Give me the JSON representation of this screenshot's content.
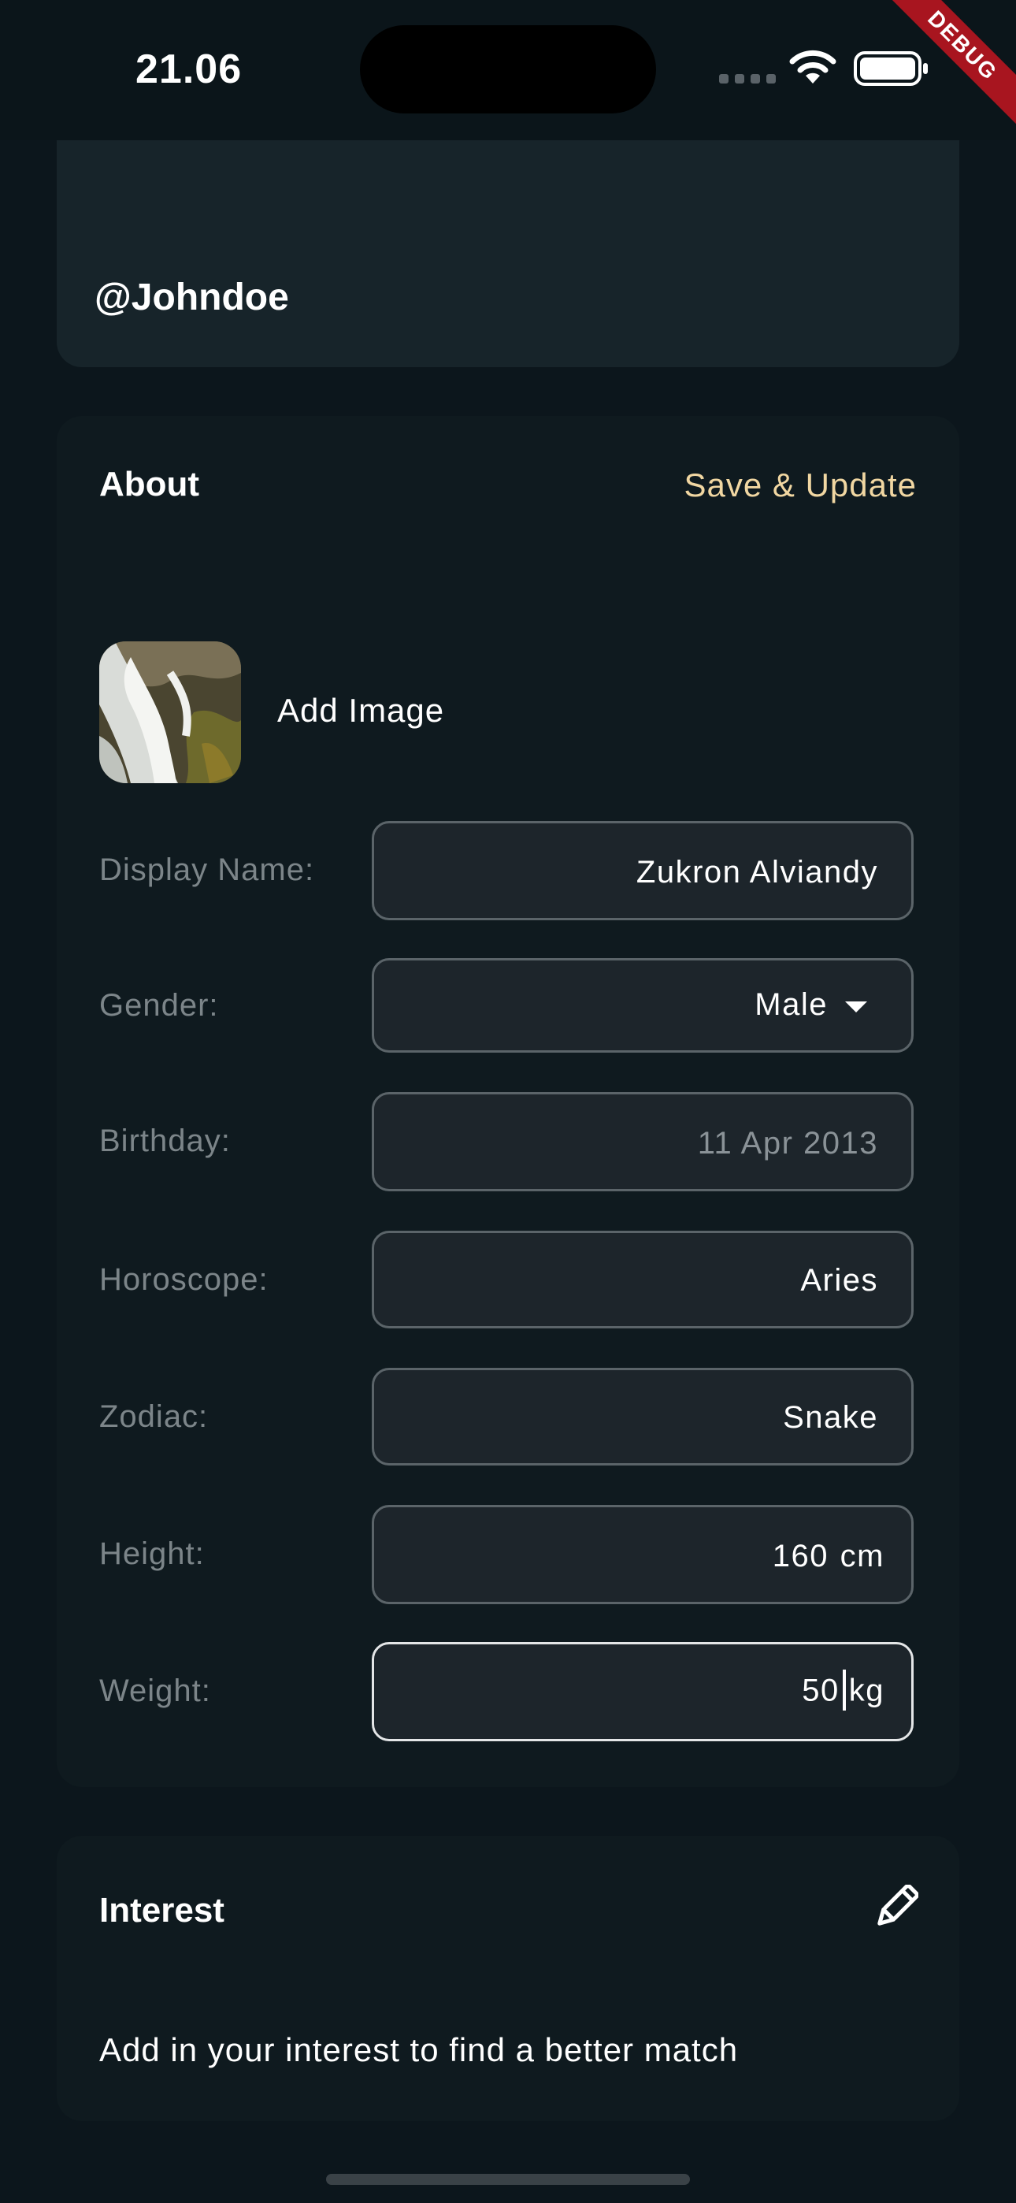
{
  "status_bar": {
    "time": "21.06",
    "debug_label": "DEBUG"
  },
  "profile": {
    "username": "@Johndoe"
  },
  "about": {
    "title": "About",
    "save_label": "Save & Update",
    "add_image_label": "Add Image",
    "fields": {
      "display_name": {
        "label": "Display Name:",
        "value": "Zukron Alviandy"
      },
      "gender": {
        "label": "Gender:",
        "value": "Male"
      },
      "birthday": {
        "label": "Birthday:",
        "value": "11 Apr 2013"
      },
      "horoscope": {
        "label": "Horoscope:",
        "value": "Aries"
      },
      "zodiac": {
        "label": "Zodiac:",
        "value": "Snake"
      },
      "height": {
        "label": "Height:",
        "value": "160",
        "unit": "cm"
      },
      "weight": {
        "label": "Weight:",
        "value": "50",
        "unit": "kg"
      }
    }
  },
  "interest": {
    "title": "Interest",
    "hint": "Add in your interest to find a better match"
  },
  "colors": {
    "background": "#0c161c",
    "card": "#0f1a1f",
    "header_card": "#17242a",
    "accent_gold": "#f1d7a2",
    "field_fill": "#1d252b",
    "field_border": "#5b6469",
    "label_gray": "#7c8589",
    "debug_red": "#a8151f"
  },
  "icons": [
    "wifi-icon",
    "battery-icon",
    "dropdown-arrow-icon",
    "pencil-icon"
  ]
}
